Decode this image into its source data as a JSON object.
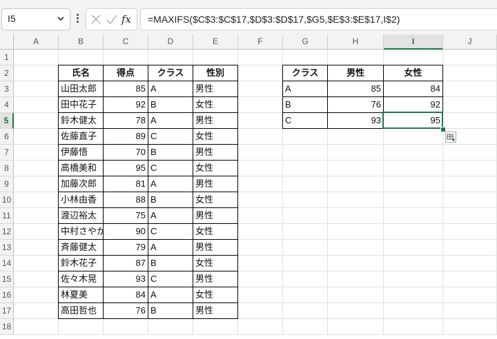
{
  "name_box": "I5",
  "formula": "=MAXIFS($C$3:$C$17,$D$3:$D$17,$G5,$E$3:$E$17,I$2)",
  "fx_label": "fx",
  "columns": [
    "A",
    "B",
    "C",
    "D",
    "E",
    "F",
    "G",
    "H",
    "I",
    "J"
  ],
  "rows": [
    "1",
    "2",
    "3",
    "4",
    "5",
    "6",
    "7",
    "8",
    "9",
    "10",
    "11",
    "12",
    "13",
    "14",
    "15",
    "16",
    "17",
    "18"
  ],
  "selected_cell": "I5",
  "table1": {
    "headers": [
      "氏名",
      "得点",
      "クラス",
      "性別"
    ],
    "rows": [
      [
        "山田太郎",
        "85",
        "A",
        "男性"
      ],
      [
        "田中花子",
        "92",
        "B",
        "女性"
      ],
      [
        "鈴木健太",
        "78",
        "A",
        "男性"
      ],
      [
        "佐藤直子",
        "89",
        "C",
        "女性"
      ],
      [
        "伊藤悟",
        "70",
        "B",
        "男性"
      ],
      [
        "高橋美和",
        "95",
        "C",
        "女性"
      ],
      [
        "加藤次郎",
        "81",
        "A",
        "男性"
      ],
      [
        "小林由香",
        "88",
        "B",
        "女性"
      ],
      [
        "渡辺裕太",
        "75",
        "A",
        "男性"
      ],
      [
        "中村さやか",
        "90",
        "C",
        "女性"
      ],
      [
        "斉藤健太",
        "79",
        "A",
        "男性"
      ],
      [
        "鈴木花子",
        "87",
        "B",
        "女性"
      ],
      [
        "佐々木晃",
        "93",
        "C",
        "男性"
      ],
      [
        "林夏美",
        "84",
        "A",
        "女性"
      ],
      [
        "高田哲也",
        "76",
        "B",
        "男性"
      ]
    ]
  },
  "table2": {
    "headers": [
      "クラス",
      "男性",
      "女性"
    ],
    "rows": [
      [
        "A",
        "85",
        "84"
      ],
      [
        "B",
        "76",
        "92"
      ],
      [
        "C",
        "93",
        "95"
      ]
    ]
  }
}
